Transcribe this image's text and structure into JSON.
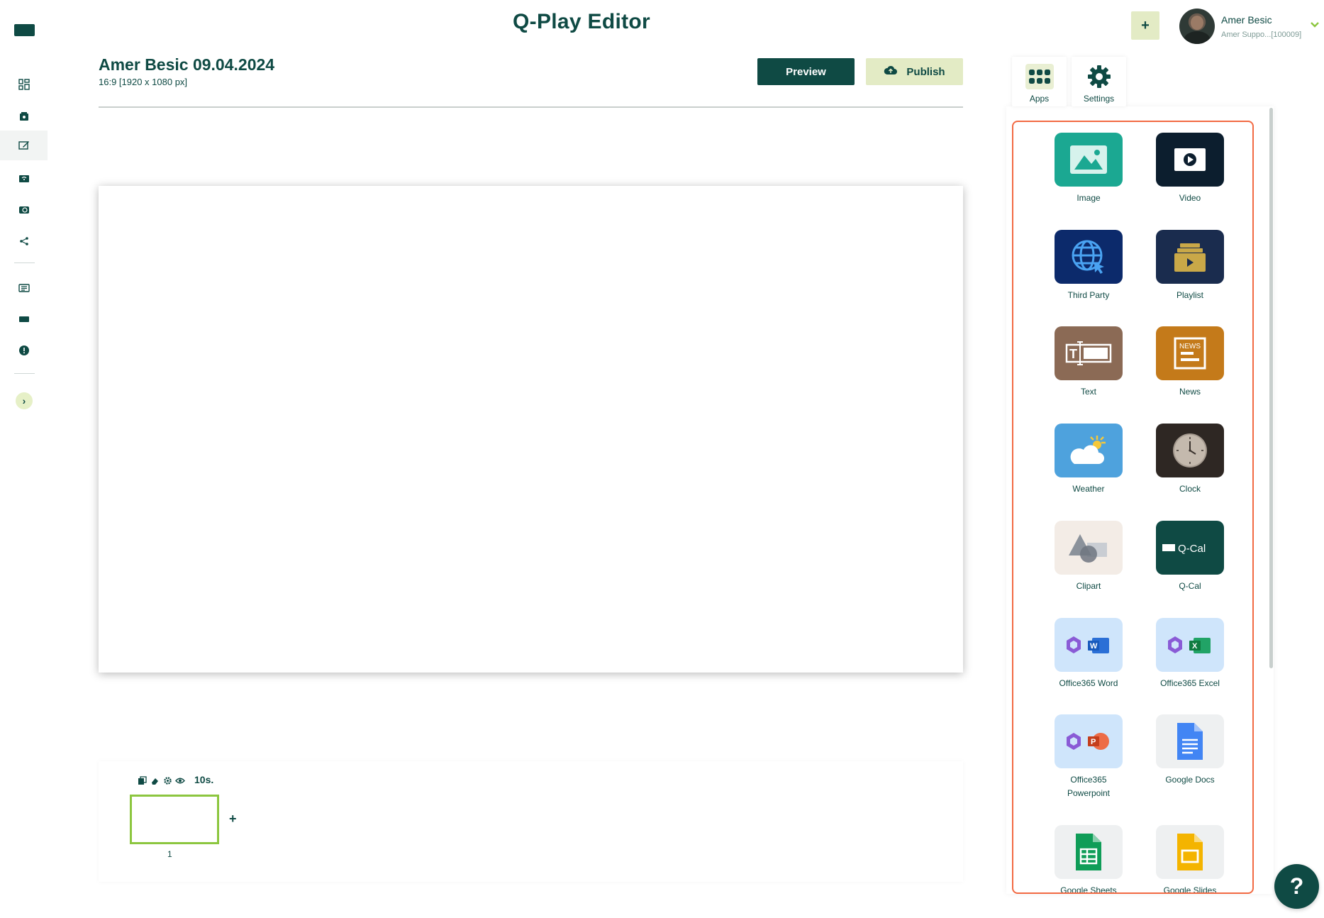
{
  "header": {
    "app_title": "Q-Play Editor",
    "add_button": "+",
    "user_name": "Amer Besic",
    "user_sub": "Amer Suppo...[100009]"
  },
  "document": {
    "title": "Amer Besic 09.04.2024",
    "size": "16:9 [1920 x 1080 px]",
    "preview_label": "Preview",
    "publish_label": "Publish"
  },
  "timeline": {
    "duration": "10s.",
    "slide_number": "1",
    "add_label": "+"
  },
  "panel": {
    "tabs": [
      {
        "label": "Apps",
        "icon": "grid-icon"
      },
      {
        "label": "Settings",
        "icon": "gear-icon"
      }
    ],
    "apps": [
      {
        "label": "Image",
        "color": "#1ba892"
      },
      {
        "label": "Video",
        "color": "#0c1e2e"
      },
      {
        "label": "Third Party",
        "color": "#0c2a6b"
      },
      {
        "label": "Playlist",
        "color": "#1a2c4e"
      },
      {
        "label": "Text",
        "color": "#8b6a55"
      },
      {
        "label": "News",
        "color": "#c47a1a"
      },
      {
        "label": "Weather",
        "color": "#4ea2dd"
      },
      {
        "label": "Clock",
        "color": "#2e2723"
      },
      {
        "label": "Clipart",
        "color": "#f3ece6"
      },
      {
        "label": "Q-Cal",
        "color": "#0f4a44"
      },
      {
        "label": "Office365 Word",
        "color": "#cfe5fb"
      },
      {
        "label": "Office365 Excel",
        "color": "#cfe5fb"
      },
      {
        "label": "Office365 Powerpoint",
        "color": "#cfe5fb"
      },
      {
        "label": "Google Docs",
        "color": "#eef0f1"
      },
      {
        "label": "Google Sheets",
        "color": "#eef0f1"
      },
      {
        "label": "Google Slides",
        "color": "#eef0f1"
      }
    ],
    "qcal_text": "Q-Cal",
    "news_text": "NEWS"
  },
  "help": {
    "label": "?"
  }
}
